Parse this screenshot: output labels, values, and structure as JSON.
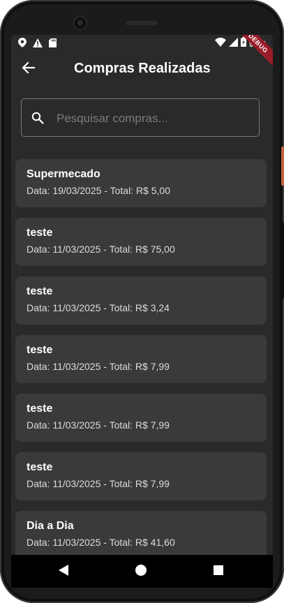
{
  "status_bar": {
    "time": "9:59",
    "debug_label": "DEBUG",
    "icons": [
      "location-icon",
      "warning-icon",
      "sd-card-icon",
      "wifi-icon",
      "signal-icon",
      "battery-icon"
    ]
  },
  "app_bar": {
    "title": "Compras Realizadas",
    "back_icon": "arrow-left-icon"
  },
  "search": {
    "placeholder": "Pesquisar compras...",
    "value": "",
    "icon": "search-icon"
  },
  "purchases": [
    {
      "name": "Supermecado",
      "info": "Data: 19/03/2025 - Total: R$ 5,00"
    },
    {
      "name": "teste",
      "info": "Data: 11/03/2025 - Total: R$ 75,00"
    },
    {
      "name": "teste",
      "info": "Data: 11/03/2025 - Total: R$ 3,24"
    },
    {
      "name": "teste",
      "info": "Data: 11/03/2025 - Total: R$ 7,99"
    },
    {
      "name": "teste",
      "info": "Data: 11/03/2025 - Total: R$ 7,99"
    },
    {
      "name": "teste",
      "info": "Data: 11/03/2025 - Total: R$ 7,99"
    },
    {
      "name": "Dia a Dia",
      "info": "Data: 11/03/2025 - Total: R$ 41,60"
    }
  ],
  "nav_bar": {
    "icons": [
      "back-triangle-icon",
      "home-circle-icon",
      "recents-square-icon"
    ]
  },
  "colors": {
    "background": "#2a2a2a",
    "card": "#3a3a3a",
    "debug_banner": "#9a1c2a",
    "side_button": "#c4623d"
  }
}
